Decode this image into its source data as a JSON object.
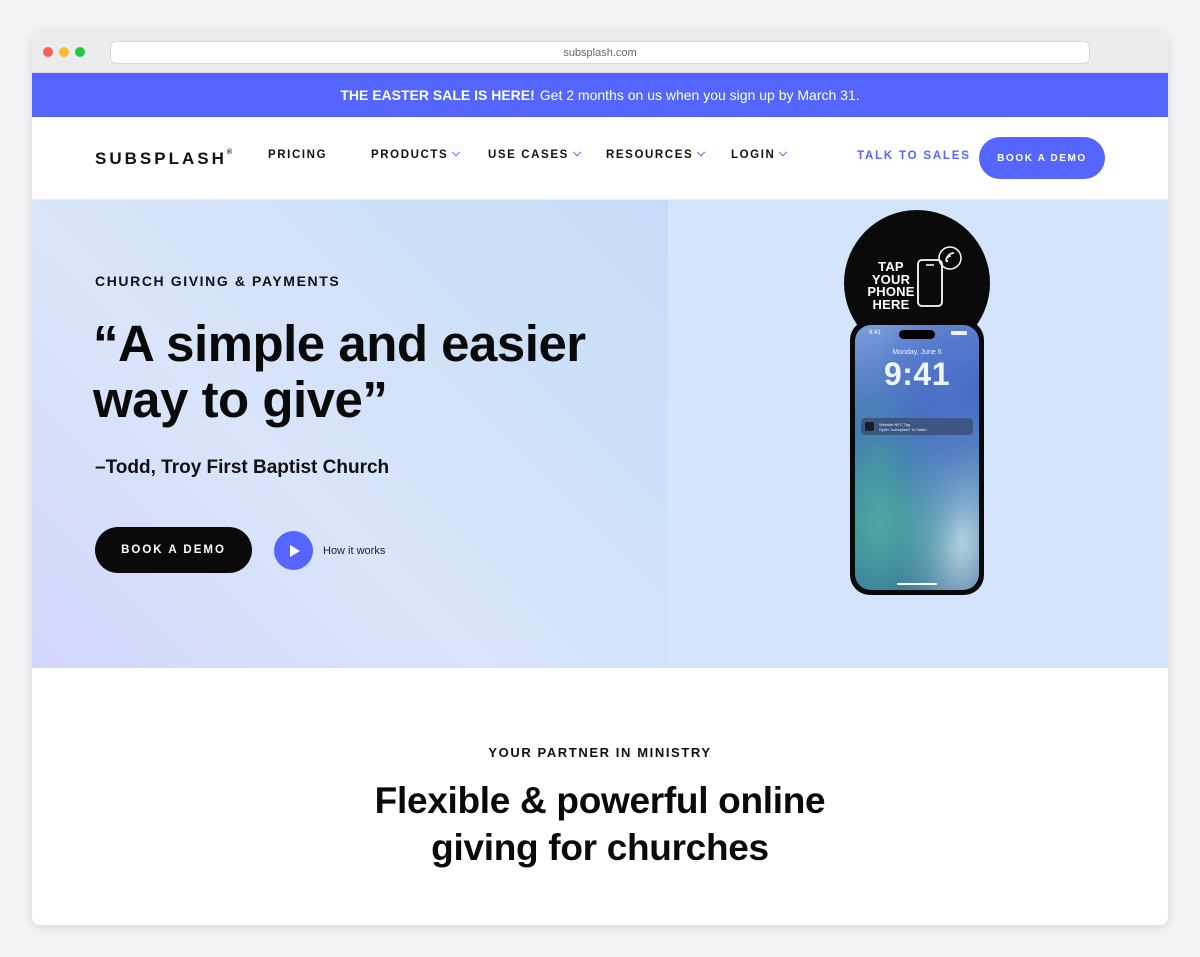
{
  "browser": {
    "url": "subsplash.com"
  },
  "banner": {
    "bold_text": "THE EASTER SALE IS HERE!",
    "text": "Get 2 months on us when you sign up by March 31."
  },
  "nav": {
    "logo": "SUBSPLASH",
    "logo_mark": "®",
    "items": [
      {
        "label": "PRICING",
        "dropdown": false
      },
      {
        "label": "PRODUCTS",
        "dropdown": true
      },
      {
        "label": "USE CASES",
        "dropdown": true
      },
      {
        "label": "RESOURCES",
        "dropdown": true
      },
      {
        "label": "LOGIN",
        "dropdown": true
      }
    ],
    "talk_to_sales": "TALK TO SALES",
    "book_demo": "BOOK A DEMO"
  },
  "hero": {
    "eyebrow": "CHURCH GIVING & PAYMENTS",
    "quote_line1": "“A simple and easier",
    "quote_line2": "way to give”",
    "attribution": "–Todd, Troy First Baptist Church",
    "cta": "BOOK A DEMO",
    "video_link": "How it works"
  },
  "tap_sign": {
    "line1": "TAP",
    "line2": "YOUR",
    "line3": "PHONE",
    "line4": "HERE"
  },
  "phone": {
    "status_time": "9:41",
    "date": "Monday, June 6",
    "time": "9:41",
    "notif_title": "Website NFC Tag",
    "notif_body": "Open \"subsplash\" in Safari"
  },
  "section": {
    "eyebrow": "YOUR PARTNER IN MINISTRY",
    "title_line1": "Flexible & powerful online",
    "title_line2": "giving for churches"
  },
  "colors": {
    "brand": "#5466ff",
    "dark": "#0a0a0a",
    "hero_right": "#d4e5fb"
  }
}
